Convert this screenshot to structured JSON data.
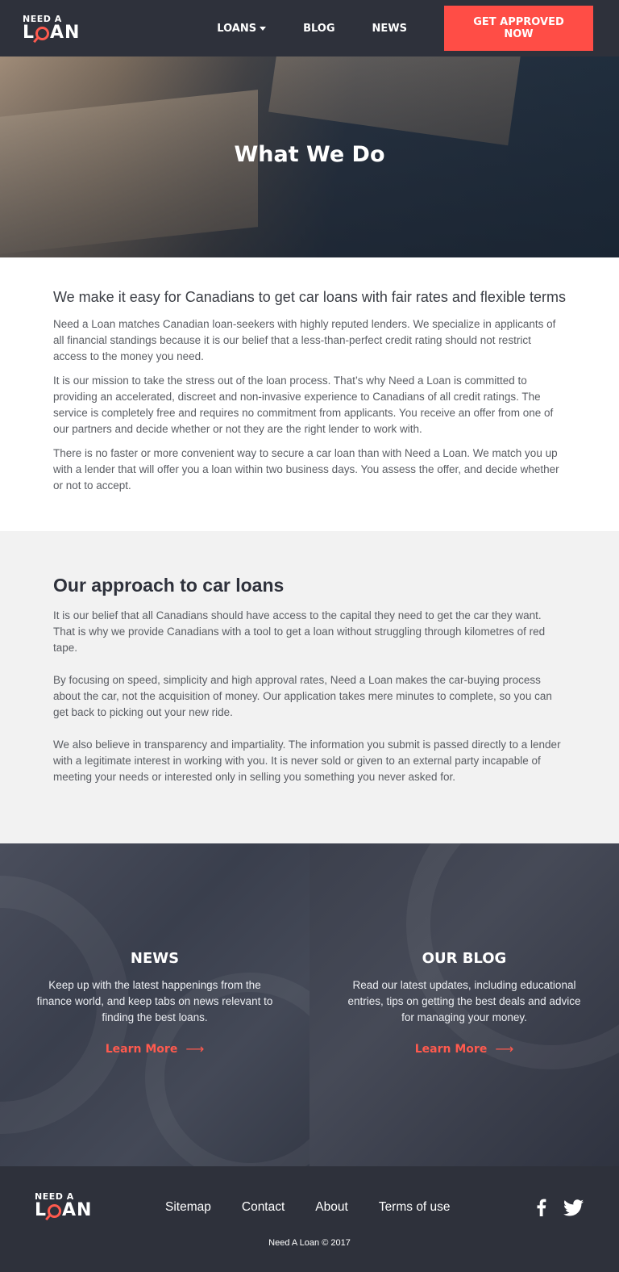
{
  "header": {
    "logo_top": "NEED A",
    "logo_bottom_l": "L",
    "logo_bottom_an": "AN",
    "nav": [
      {
        "label": "LOANS",
        "has_dropdown": true
      },
      {
        "label": "BLOG"
      },
      {
        "label": "NEWS"
      }
    ],
    "cta_label": "GET APPROVED NOW"
  },
  "hero": {
    "title": "What We Do"
  },
  "intro": {
    "heading": "We make it easy for Canadians to get car loans with fair rates and flexible terms",
    "paragraphs": [
      "Need a Loan matches Canadian loan-seekers with highly reputed lenders. We specialize in applicants of all financial standings because it is our belief that a less-than-perfect credit rating should not restrict access to the money you need.",
      "It is our mission to take the stress out of the loan process. That’s why Need a Loan is committed to providing an accelerated, discreet and non-invasive experience to Canadians of all credit ratings. The service is completely free and requires no commitment from applicants. You receive an offer from one of our partners and decide whether or not they are the right lender to work with.",
      "There is no faster or more convenient way to secure a car loan than with Need a Loan. We match you up with a lender that will offer you a loan within two business days. You assess the offer, and decide whether or not to accept."
    ]
  },
  "approach": {
    "heading": "Our approach to car loans",
    "paragraphs": [
      "It is our belief that all Canadians should have access to the capital they need to get the car they want. That is why we provide Canadians with a tool to get a loan without struggling through kilometres of red tape.",
      "By focusing on speed, simplicity and high approval rates, Need a Loan makes the car-buying process about the car, not the acquisition of money. Our application takes mere minutes to complete, so you can get back to picking out your new ride.",
      "We also believe in transparency and impartiality. The information you submit is passed directly to a lender with a legitimate interest in working with you. It is never sold or given to an external party incapable of meeting your needs or interested only in selling you something you never asked for."
    ]
  },
  "cards": [
    {
      "title": "NEWS",
      "text": "Keep up with the latest happenings from the finance world, and keep tabs on news relevant to finding the best loans.",
      "link": "Learn More",
      "arrow": "⟶"
    },
    {
      "title": "OUR BLOG",
      "text": "Read our latest updates, including educational entries, tips on getting the best deals and advice for managing your money.",
      "link": "Learn More",
      "arrow": "⟶"
    }
  ],
  "footer": {
    "links": [
      "Sitemap",
      "Contact",
      "About",
      "Terms of use"
    ],
    "copyright": "Need A Loan © 2017",
    "social": [
      "facebook-icon",
      "twitter-icon"
    ]
  },
  "colors": {
    "header_bg": "#2e313b",
    "accent": "#ff4d46",
    "section_alt_bg": "#f2f2f2"
  }
}
